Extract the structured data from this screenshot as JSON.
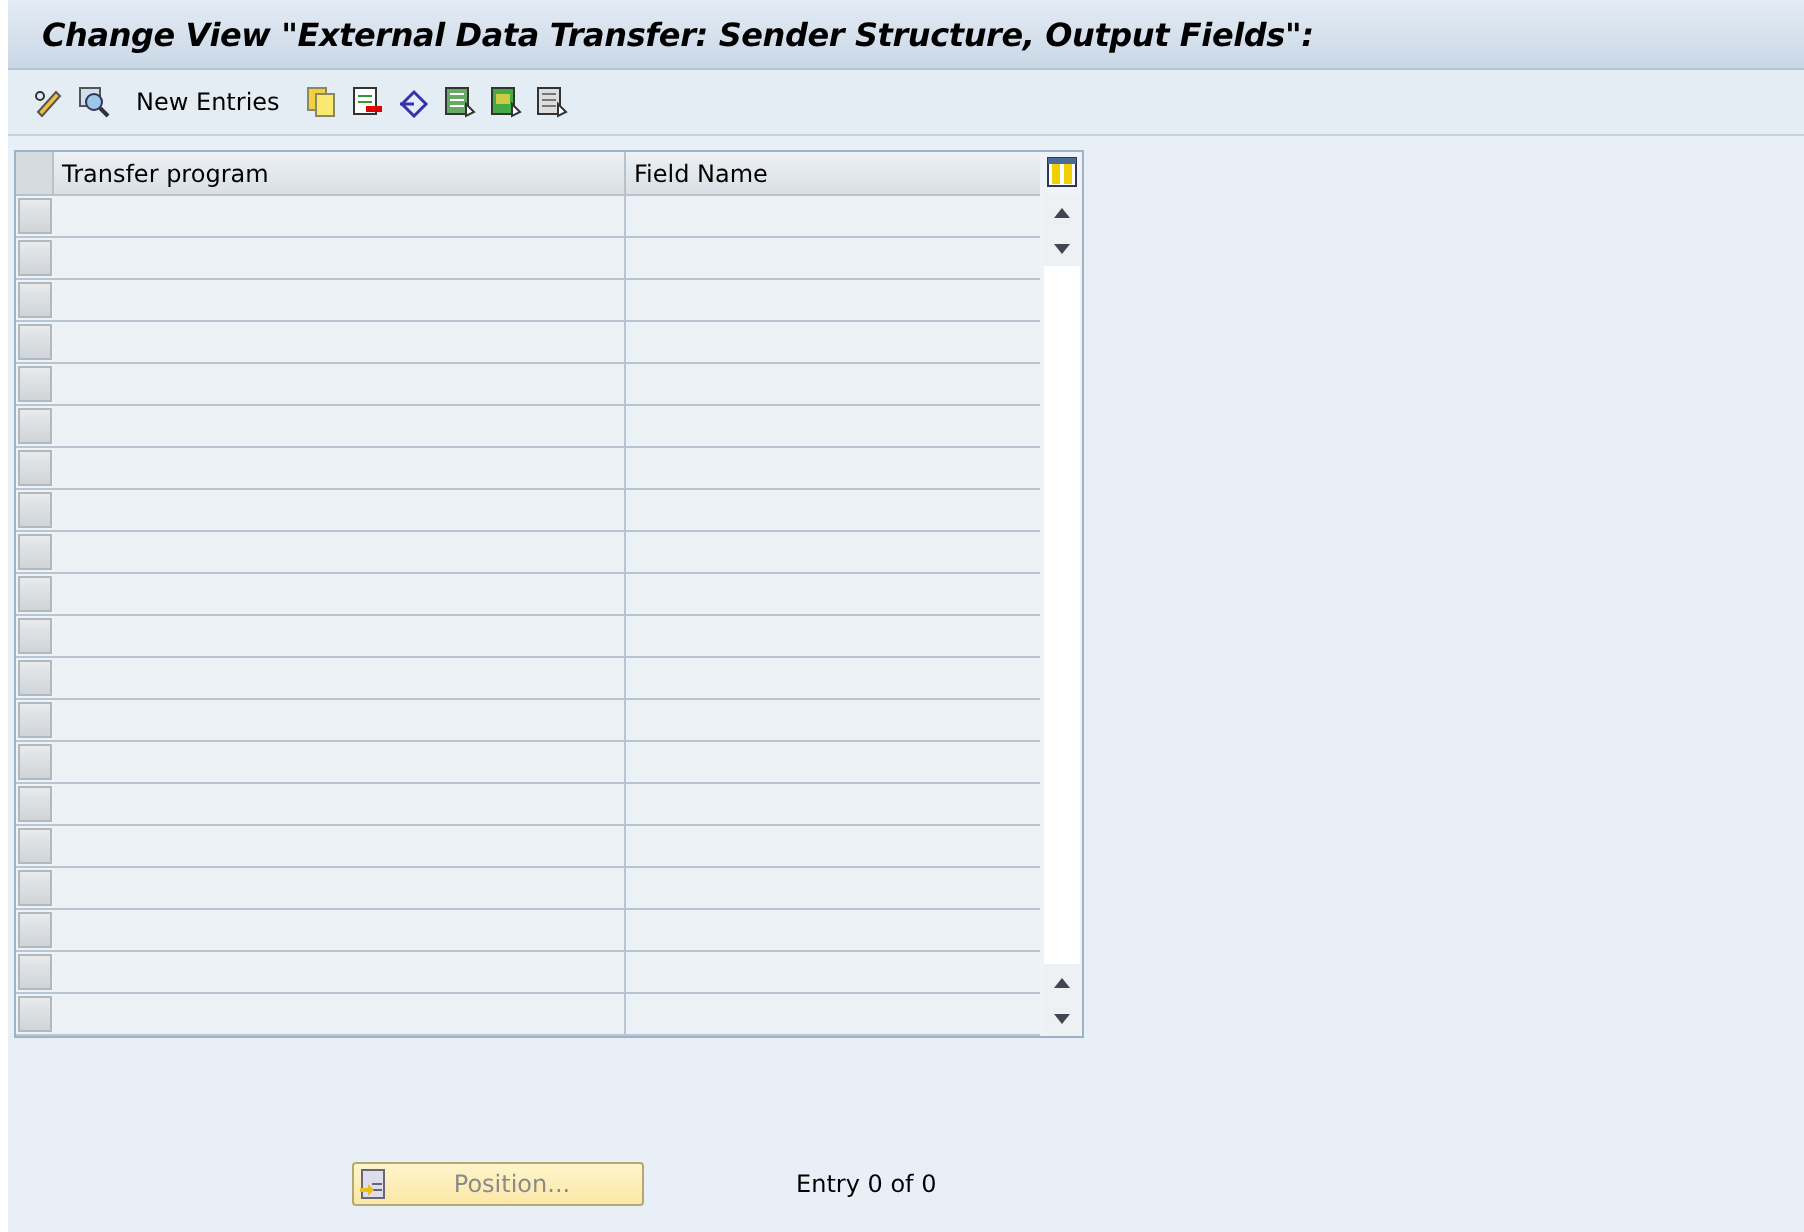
{
  "window": {
    "title": "Change View \"External Data Transfer: Sender Structure, Output Fields\":"
  },
  "toolbar": {
    "new_entries": "New Entries"
  },
  "table": {
    "columns": [
      "Transfer program",
      "Field Name"
    ]
  },
  "footer": {
    "position_button": {
      "label": "Position...",
      "disabled": true
    },
    "entry_count": "Entry 0 of 0"
  }
}
